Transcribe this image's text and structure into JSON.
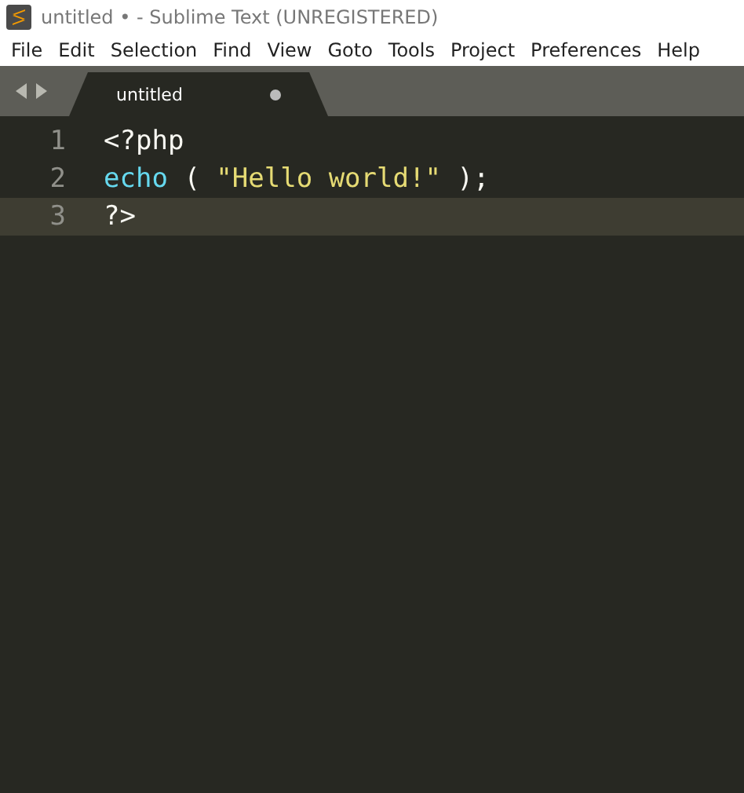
{
  "window": {
    "title": "untitled • - Sublime Text (UNREGISTERED)"
  },
  "menu": [
    "File",
    "Edit",
    "Selection",
    "Find",
    "View",
    "Goto",
    "Tools",
    "Project",
    "Preferences",
    "Help"
  ],
  "tabs": [
    {
      "label": "untitled",
      "selected": true,
      "modified": true
    }
  ],
  "lines": [
    {
      "number": "1",
      "current": false,
      "tokens": [
        {
          "text": "<?php",
          "kind": "plain"
        }
      ]
    },
    {
      "number": "2",
      "current": false,
      "tokens": [
        {
          "text": "echo",
          "kind": "keyword"
        },
        {
          "text": " ( ",
          "kind": "plain"
        },
        {
          "text": "\"Hello world!\"",
          "kind": "string"
        },
        {
          "text": " );",
          "kind": "plain"
        }
      ]
    },
    {
      "number": "3",
      "current": true,
      "tokens": [
        {
          "text": "?>",
          "kind": "plain"
        }
      ]
    }
  ]
}
